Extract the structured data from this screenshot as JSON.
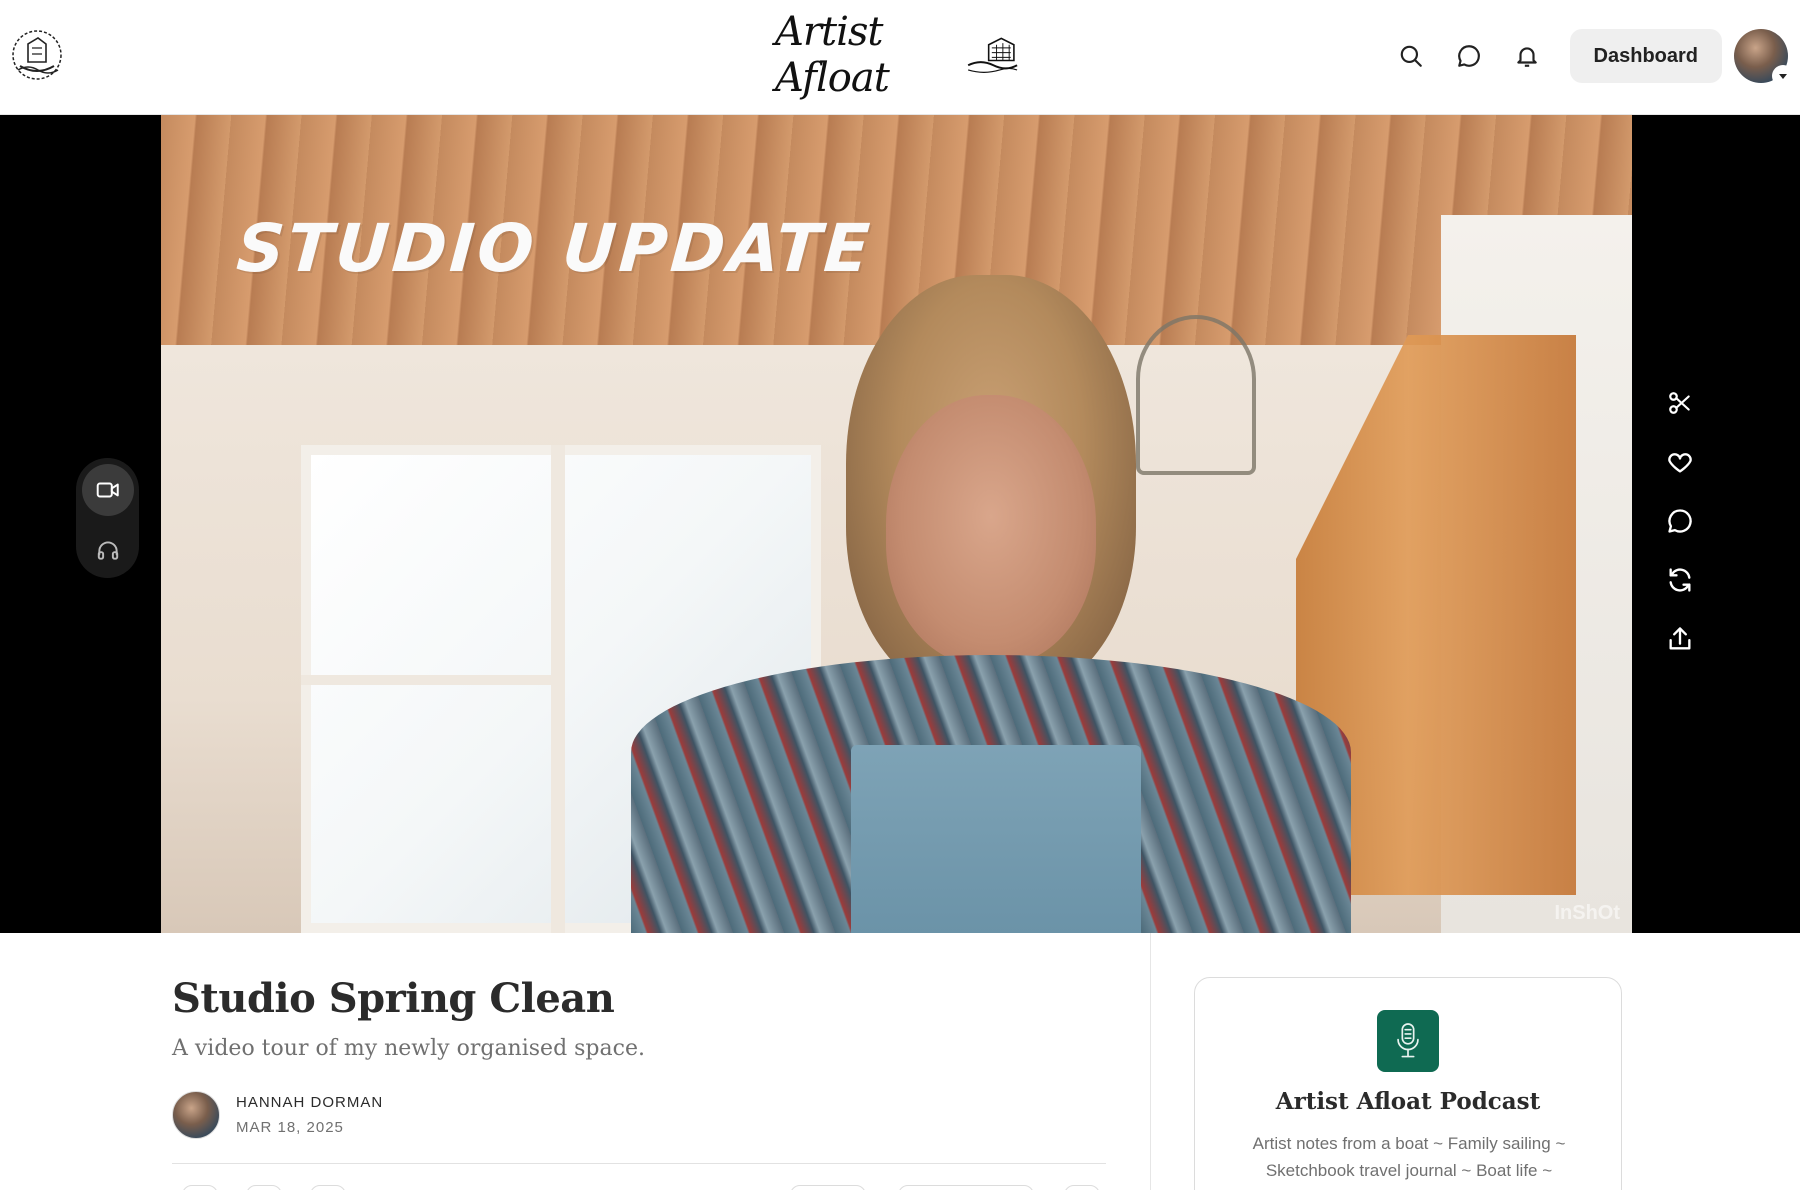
{
  "header": {
    "publication_name": "Artist Afloat",
    "dashboard_label": "Dashboard"
  },
  "video": {
    "overlay_title": "Studio update",
    "watermark": "InShOt"
  },
  "media_switch": {
    "active": "video"
  },
  "post": {
    "title": "Studio Spring Clean",
    "subtitle": "A video tour of my newly organised space.",
    "author": "HANNAH DORMAN",
    "date": "MAR 18, 2025"
  },
  "sidebar": {
    "podcast": {
      "title": "Artist Afloat Podcast",
      "description": "Artist notes from a boat ~ Family sailing ~ Sketchbook travel journal ~ Boat life ~"
    }
  },
  "colors": {
    "podcast_icon_bg": "#0f6a52",
    "dashboard_bg": "#efefef",
    "video_bg": "#000000"
  }
}
